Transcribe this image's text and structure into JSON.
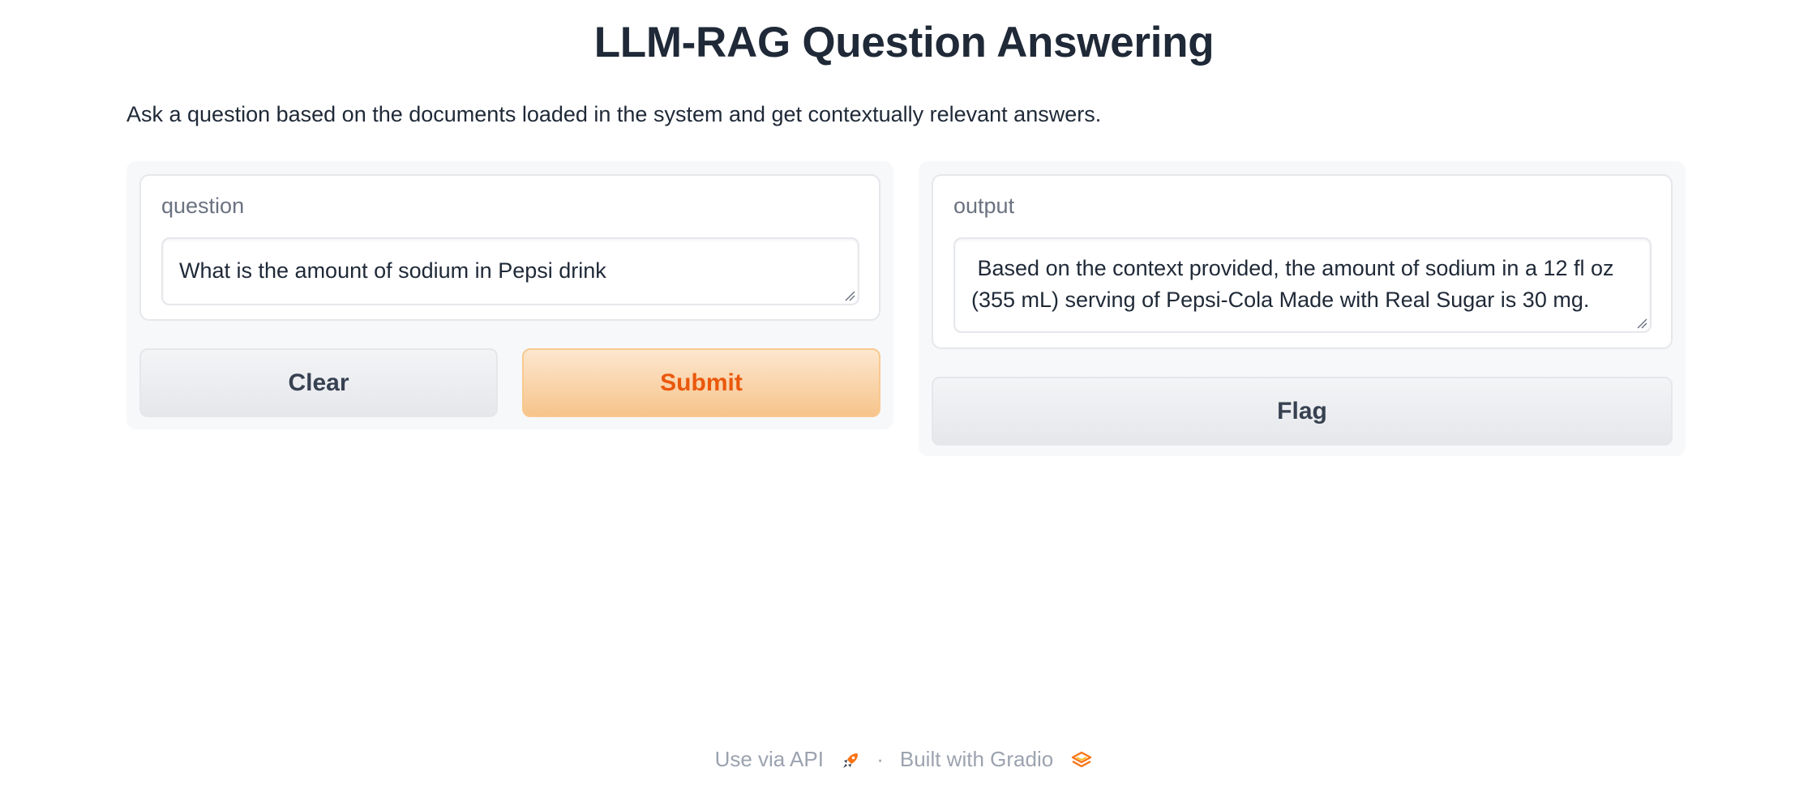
{
  "header": {
    "title": "LLM-RAG Question Answering",
    "description": "Ask a question based on the documents loaded in the system and get contextually relevant answers."
  },
  "input_panel": {
    "label": "question",
    "value": "What is the amount of sodium in Pepsi drink",
    "clear_label": "Clear",
    "submit_label": "Submit"
  },
  "output_panel": {
    "label": "output",
    "value": " Based on the context provided, the amount of sodium in a 12 fl oz (355 mL) serving of Pepsi-Cola Made with Real Sugar is 30 mg.",
    "flag_label": "Flag"
  },
  "footer": {
    "api_label": "Use via API",
    "separator": "·",
    "built_label": "Built with Gradio",
    "api_icon": "rocket-icon",
    "gradio_icon": "gradio-logo-icon"
  },
  "colors": {
    "accent": "#ea580c",
    "primary_button_top": "#fde7cf",
    "primary_button_bottom": "#f6c48b",
    "text": "#1f2937",
    "muted": "#9ca3af"
  }
}
